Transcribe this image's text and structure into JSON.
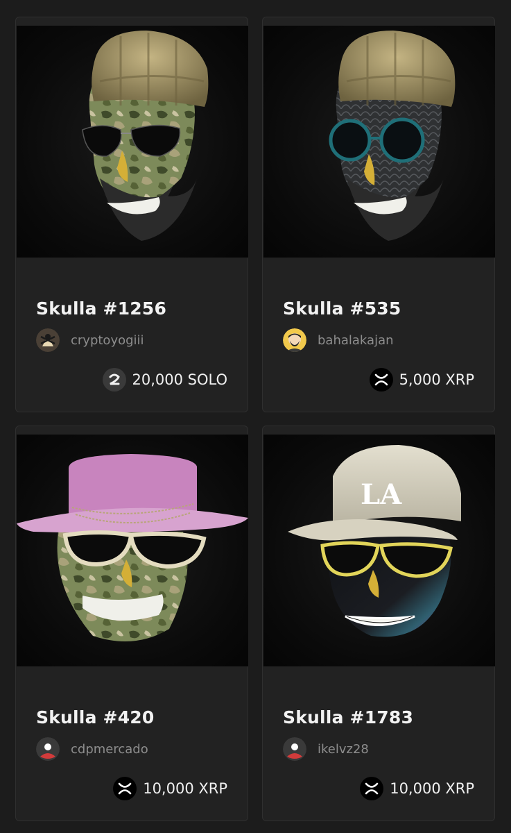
{
  "cards": [
    {
      "title": "Skulla #1256",
      "owner": "cryptoyogiii",
      "avatar_icon": "ninja-avatar-icon",
      "price": "20,000 SOLO",
      "currency_icon": "solo-token-icon",
      "art": {
        "hat": "beanie",
        "hat_color": "#a89a6a",
        "skull": "camo-green",
        "glasses": "aviator-black",
        "beard": true
      }
    },
    {
      "title": "Skulla #535",
      "owner": "bahalakajan",
      "avatar_icon": "bearded-man-avatar-icon",
      "price": "5,000 XRP",
      "currency_icon": "xrp-token-icon",
      "art": {
        "hat": "beanie",
        "hat_color": "#a89a6a",
        "skull": "black-scales",
        "glasses": "round-teal",
        "beard": true
      }
    },
    {
      "title": "Skulla #420",
      "owner": "cdpmercado",
      "avatar_icon": "default-user-avatar-icon",
      "price": "10,000 XRP",
      "currency_icon": "xrp-token-icon",
      "art": {
        "hat": "wide-brim",
        "hat_color": "#c884be",
        "skull": "camo-green",
        "glasses": "shield-cream",
        "beard": false
      }
    },
    {
      "title": "Skulla #1783",
      "owner": "ikelvz28",
      "avatar_icon": "default-user-avatar-icon",
      "price": "10,000 XRP",
      "currency_icon": "xrp-token-icon",
      "art": {
        "hat": "baseball-cap",
        "hat_color": "#d9d4c2",
        "cap_logo": "LA",
        "skull": "black-iridescent",
        "glasses": "shield-yellow",
        "beard": false
      }
    }
  ]
}
